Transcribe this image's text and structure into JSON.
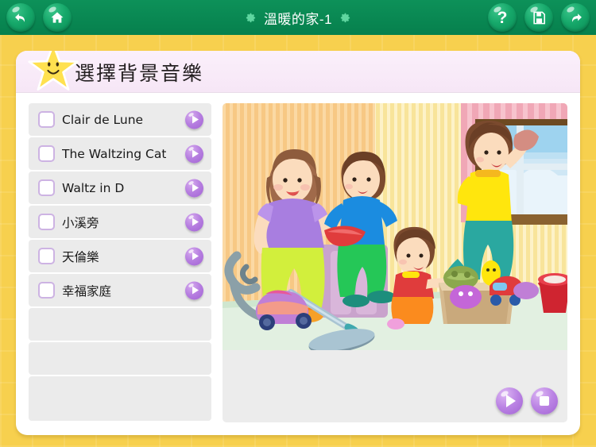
{
  "topbar": {
    "title": "溫暖的家-1",
    "left_buttons": [
      {
        "name": "back-button",
        "icon": "undo-arrow-icon",
        "label": "返回"
      },
      {
        "name": "home-button",
        "icon": "home-icon",
        "label": "首頁"
      }
    ],
    "right_buttons": [
      {
        "name": "help-button",
        "icon": "question-mark-icon",
        "label": "?"
      },
      {
        "name": "save-button",
        "icon": "floppy-disk-icon",
        "label": "儲存"
      },
      {
        "name": "next-button",
        "icon": "redo-arrow-icon",
        "label": "下一步"
      }
    ],
    "gear_icon": "gear-icon"
  },
  "card": {
    "title": "選擇背景音樂",
    "star_icon": "smiling-star-icon"
  },
  "music_list": {
    "items": [
      {
        "label": "Clair de Lune",
        "checked": false
      },
      {
        "label": "The Waltzing Cat",
        "checked": false
      },
      {
        "label": "Waltz in D",
        "checked": false
      },
      {
        "label": "小溪旁",
        "checked": false
      },
      {
        "label": "天倫樂",
        "checked": false
      },
      {
        "label": "幸福家庭",
        "checked": false
      }
    ],
    "empty_rows": 3,
    "play_icon": "play-icon",
    "checkbox_icon": "checkbox-icon"
  },
  "preview": {
    "alt": "家庭一起打掃房間的插圖",
    "controls": [
      {
        "name": "preview-play-button",
        "icon": "play-icon"
      },
      {
        "name": "preview-stop-button",
        "icon": "stop-icon"
      }
    ]
  },
  "colors": {
    "toolbar_green": "#0b8a56",
    "page_gold": "#f7d04e",
    "header_pink": "#f8eaf8",
    "row_gray": "#ebebeb",
    "accent_purple": "#a263d4",
    "checkbox_border": "#cdb3e3"
  }
}
